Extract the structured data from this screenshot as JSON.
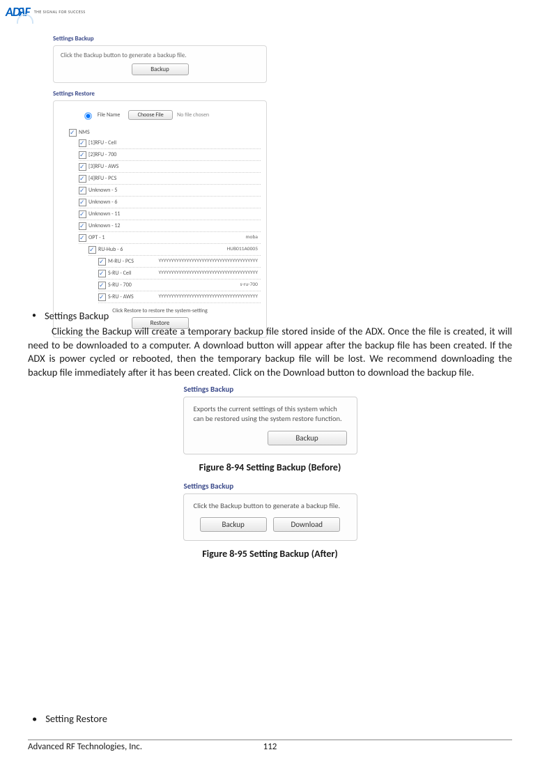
{
  "header": {
    "brand_a": "A",
    "brand_d": "D",
    "brand_r": "R",
    "brand_f": "F",
    "tagline": "THE SIGNAL FOR SUCCESS"
  },
  "screenshot1": {
    "backup_title": "Settings Backup",
    "backup_card_text": "Click the Backup button to generate a backup file.",
    "backup_btn": "Backup",
    "restore_title": "Settings Restore",
    "file_name_label": "File Name",
    "choose_file_btn": "Choose File",
    "no_file_chosen": "No file chosen",
    "nms_label": "NMS",
    "items": [
      "[1]RFU - Cell",
      "[2]RFU - 700",
      "[3]RFU - AWS",
      "[4]RFU - PCS",
      "Unknown - 5",
      "Unknown - 6",
      "Unknown - 11",
      "Unknown - 12"
    ],
    "opt_label": "OPT - 1",
    "opt_right": "moba",
    "hub_label": "RU-Hub - 6",
    "hub_right": "HUB011A0005",
    "sub": [
      {
        "l": "M-RU - PCS",
        "r": "YYYYYYYYYYYYYYYYYYYYYYYYYYYYYYYYYYYYYYY"
      },
      {
        "l": "S-RU - Cell",
        "r": "YYYYYYYYYYYYYYYYYYYYYYYYYYYYYYYYYYYYYYY"
      },
      {
        "l": "S-RU - 700",
        "r": "s-ru-700"
      },
      {
        "l": "S-RU - AWS",
        "r": "YYYYYYYYYYYYYYYYYYYYYYYYYYYYYYYYYYYYYYY"
      }
    ],
    "restore_caption": "Click Restore to restore the system-setting",
    "restore_btn": "Restore"
  },
  "body": {
    "bullet1": "Settings Backup",
    "para1": "Clicking the Backup will create a temporary backup file stored inside of the ADX.  Once the file is created, it will need to be downloaded to a computer.  A download button will appear after the backup file has been created.  If the ADX is power cycled or rebooted, then the temporary backup file will be lost.  We recommend downloading the backup file immediately after it has been created.  Click on the Download button to download the backup file.",
    "fig1": {
      "title": "Settings Backup",
      "text": "Exports the current settings of this system which can be restored using the system restore function.",
      "btn": "Backup",
      "caption": "Figure 8-94    Setting Backup (Before)"
    },
    "fig2": {
      "title": "Settings Backup",
      "text": "Click the Backup button to generate a backup file.",
      "btn1": "Backup",
      "btn2": "Download",
      "caption": "Figure 8-95    Setting Backup (After)"
    },
    "bullet2": "Setting Restore"
  },
  "footer": {
    "company": "Advanced RF Technologies, Inc.",
    "page": "112"
  }
}
